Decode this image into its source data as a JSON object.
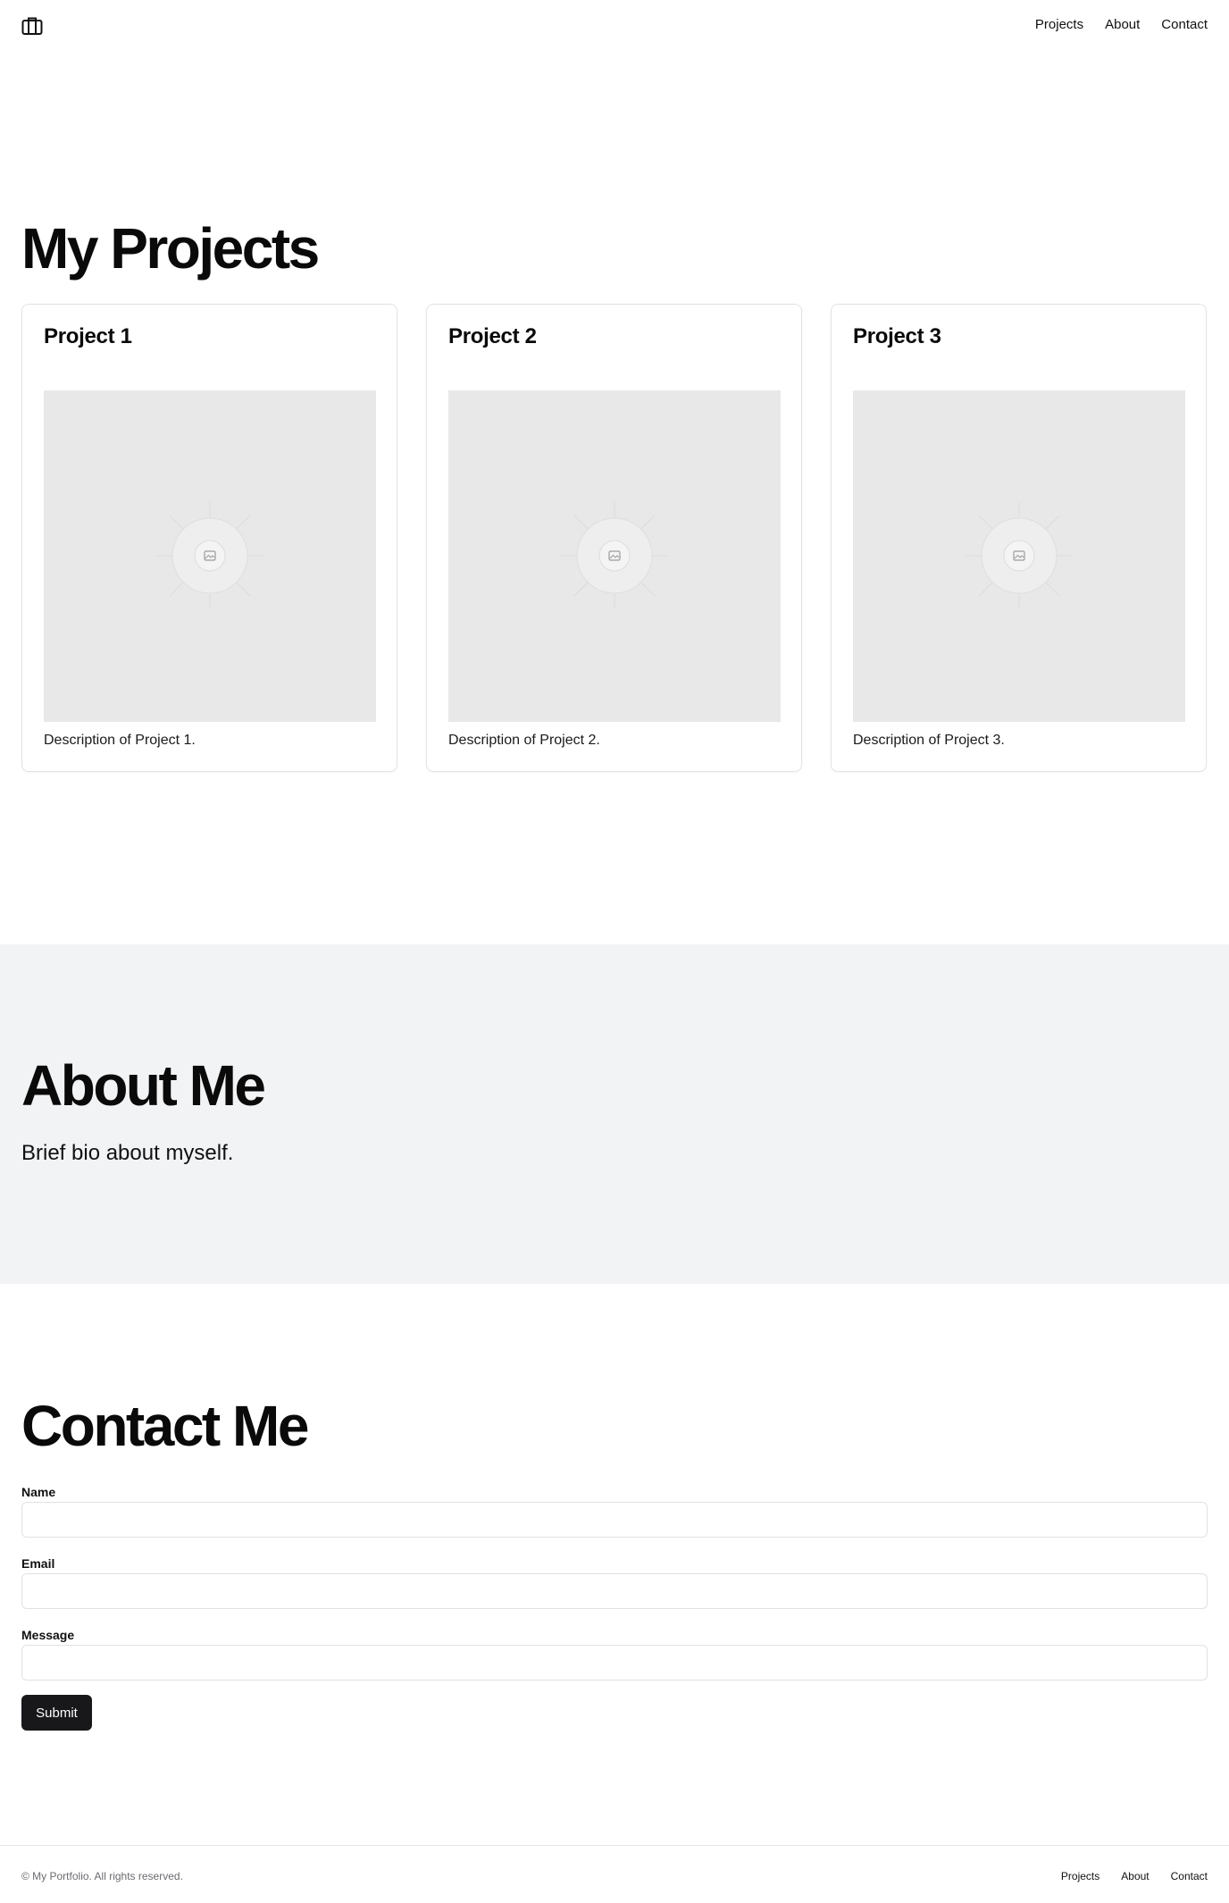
{
  "header": {
    "logo_icon": "briefcase-icon",
    "nav": [
      {
        "label": "Projects"
      },
      {
        "label": "About"
      },
      {
        "label": "Contact"
      }
    ]
  },
  "projects": {
    "title": "My Projects",
    "cards": [
      {
        "title": "Project 1",
        "description": "Description of Project 1.",
        "image_icon": "image-placeholder-icon"
      },
      {
        "title": "Project 2",
        "description": "Description of Project 2.",
        "image_icon": "image-placeholder-icon"
      },
      {
        "title": "Project 3",
        "description": "Description of Project 3.",
        "image_icon": "image-placeholder-icon"
      }
    ]
  },
  "about": {
    "title": "About Me",
    "bio": "Brief bio about myself."
  },
  "contact": {
    "title": "Contact Me",
    "fields": [
      {
        "label": "Name",
        "value": ""
      },
      {
        "label": "Email",
        "value": ""
      },
      {
        "label": "Message",
        "value": ""
      }
    ],
    "submit_label": "Submit"
  },
  "footer": {
    "copyright": "© My Portfolio. All rights reserved.",
    "nav": [
      {
        "label": "Projects"
      },
      {
        "label": "About"
      },
      {
        "label": "Contact"
      }
    ]
  },
  "colors": {
    "accent": "#18181b",
    "about_background": "#f2f3f5",
    "image_placeholder": "#e8e8e8"
  }
}
